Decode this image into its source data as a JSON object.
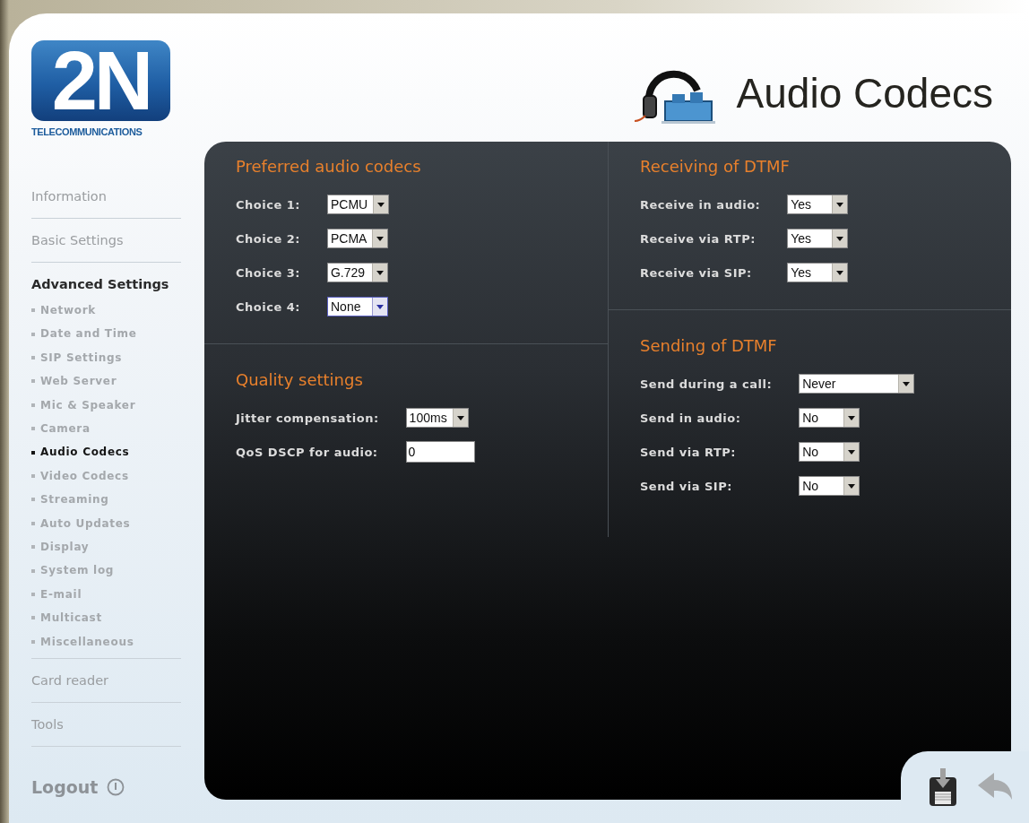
{
  "logo": {
    "mark": "2N",
    "tagline": "TELECOMMUNICATIONS"
  },
  "page_title": "Audio Codecs",
  "sidebar": {
    "items": [
      {
        "label": "Information",
        "selected": false
      },
      {
        "label": "Basic Settings",
        "selected": false
      },
      {
        "label": "Advanced Settings",
        "selected": true,
        "children": [
          {
            "label": "Network",
            "selected": false
          },
          {
            "label": "Date and Time",
            "selected": false
          },
          {
            "label": "SIP Settings",
            "selected": false
          },
          {
            "label": "Web Server",
            "selected": false
          },
          {
            "label": "Mic & Speaker",
            "selected": false
          },
          {
            "label": "Camera",
            "selected": false
          },
          {
            "label": "Audio Codecs",
            "selected": true
          },
          {
            "label": "Video Codecs",
            "selected": false
          },
          {
            "label": "Streaming",
            "selected": false
          },
          {
            "label": "Auto Updates",
            "selected": false
          },
          {
            "label": "Display",
            "selected": false
          },
          {
            "label": "System log",
            "selected": false
          },
          {
            "label": "E-mail",
            "selected": false
          },
          {
            "label": "Multicast",
            "selected": false
          },
          {
            "label": "Miscellaneous",
            "selected": false
          }
        ]
      },
      {
        "label": "Card reader",
        "selected": false
      },
      {
        "label": "Tools",
        "selected": false
      }
    ],
    "logout": "Logout"
  },
  "columns": [
    {
      "sections": [
        {
          "title": "Preferred audio codecs",
          "rows": [
            {
              "label": "Choice 1:",
              "kind": "select",
              "value": "PCMU",
              "focused": false
            },
            {
              "label": "Choice 2:",
              "kind": "select",
              "value": "PCMA",
              "focused": false
            },
            {
              "label": "Choice 3:",
              "kind": "select",
              "value": "G.729",
              "focused": false
            },
            {
              "label": "Choice 4:",
              "kind": "select",
              "value": "None",
              "focused": true
            }
          ]
        },
        {
          "title": "Quality settings",
          "rows": [
            {
              "label": "Jitter compensation:",
              "kind": "select",
              "value": "100ms",
              "focused": false
            },
            {
              "label": "QoS DSCP for audio:",
              "kind": "input",
              "value": "0"
            }
          ]
        }
      ]
    },
    {
      "sections": [
        {
          "title": "Receiving of DTMF",
          "rows": [
            {
              "label": "Receive in audio:",
              "kind": "select",
              "value": "Yes",
              "focused": false
            },
            {
              "label": "Receive via RTP:",
              "kind": "select",
              "value": "Yes",
              "focused": false
            },
            {
              "label": "Receive via SIP:",
              "kind": "select",
              "value": "Yes",
              "focused": false
            }
          ]
        },
        {
          "title": "Sending of DTMF",
          "rows": [
            {
              "label": "Send during a call:",
              "kind": "select",
              "value": "Never",
              "focused": false
            },
            {
              "label": "Send in audio:",
              "kind": "select",
              "value": "No",
              "focused": false
            },
            {
              "label": "Send via RTP:",
              "kind": "select",
              "value": "No",
              "focused": false
            },
            {
              "label": "Send via SIP:",
              "kind": "select",
              "value": "No",
              "focused": false
            }
          ]
        }
      ]
    }
  ]
}
